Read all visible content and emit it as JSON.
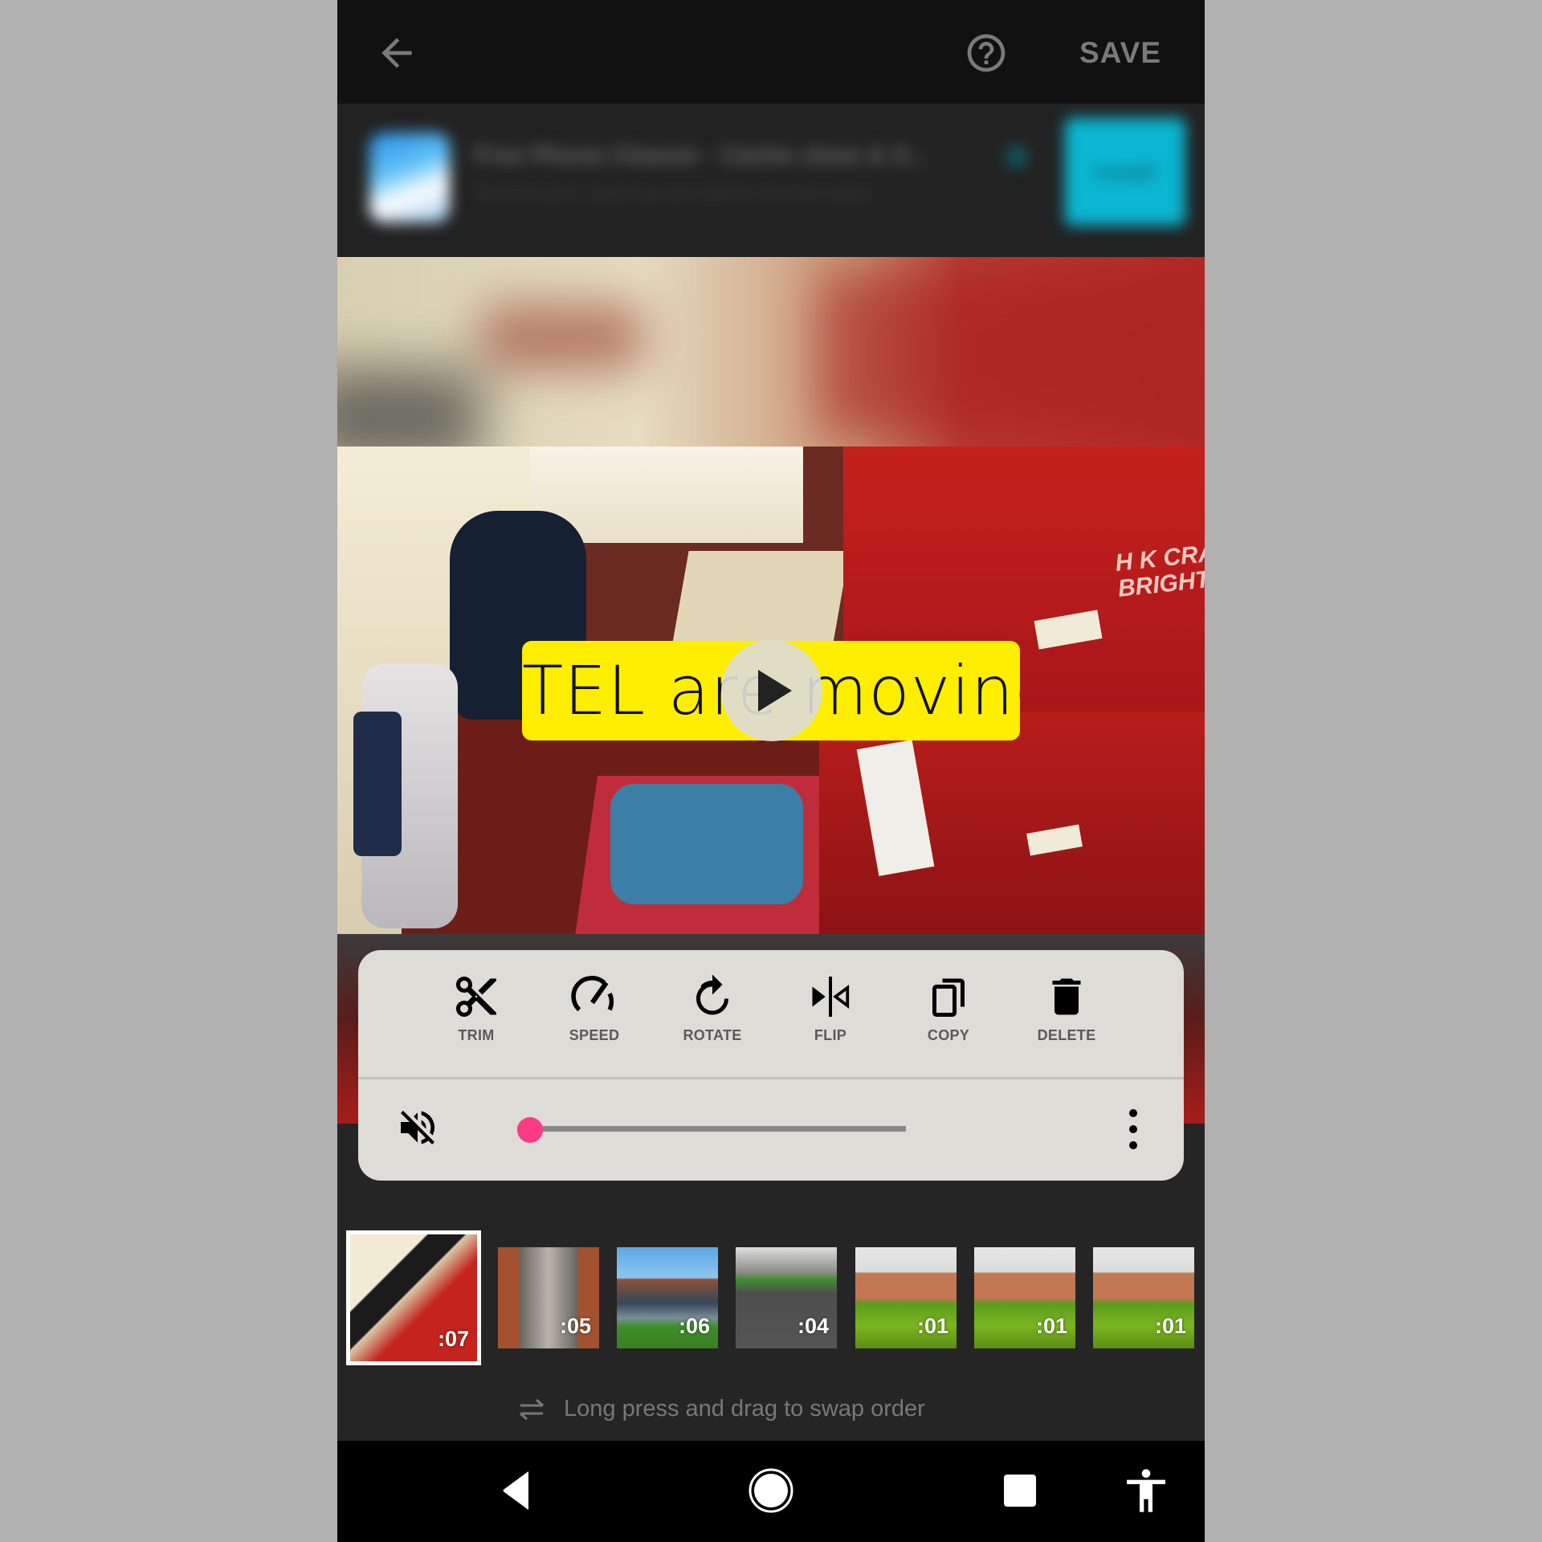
{
  "app_bar": {
    "back_icon": "arrow-left-icon",
    "help_icon": "help-circle-icon",
    "save_label": "SAVE"
  },
  "ad_banner": {
    "title": "Free Phone Cleaner - Cache clean & S...",
    "subtitle": "Remove junk, speed up your phone and free space",
    "cta_label": "Install",
    "note": "blurred advertisement"
  },
  "preview": {
    "caption_text": "TEL are moving",
    "caption_bg_color": "#ffee00",
    "crate_text_line1": "H K CRAT",
    "crate_text_line2": "BRIGHTON O",
    "play_icon": "play-icon"
  },
  "clip_tools": [
    {
      "id": "trim",
      "label": "TRIM",
      "icon": "scissors-icon"
    },
    {
      "id": "speed",
      "label": "SPEED",
      "icon": "speedometer-icon"
    },
    {
      "id": "rotate",
      "label": "ROTATE",
      "icon": "rotate-icon"
    },
    {
      "id": "flip",
      "label": "FLIP",
      "icon": "flip-icon"
    },
    {
      "id": "copy",
      "label": "COPY",
      "icon": "copy-icon"
    },
    {
      "id": "delete",
      "label": "DELETE",
      "icon": "trash-icon"
    }
  ],
  "volume": {
    "muted": true,
    "icon": "volume-off-icon",
    "level_percent": 0,
    "accent_color": "#fd3a84",
    "more_icon": "more-vertical-icon"
  },
  "clips": [
    {
      "duration": ":07",
      "selected": true,
      "scene": "office"
    },
    {
      "duration": ":05",
      "selected": false,
      "scene": "corridor"
    },
    {
      "duration": ":06",
      "selected": false,
      "scene": "building"
    },
    {
      "duration": ":04",
      "selected": false,
      "scene": "path"
    },
    {
      "duration": ":01",
      "selected": false,
      "scene": "grass"
    },
    {
      "duration": ":01",
      "selected": false,
      "scene": "grass"
    },
    {
      "duration": ":01",
      "selected": false,
      "scene": "grass"
    }
  ],
  "hint": {
    "icon": "swap-icon",
    "text": "Long press and drag to swap order"
  },
  "system_nav": {
    "back": "nav-back-icon",
    "home": "nav-home-icon",
    "recents": "nav-recents-icon",
    "accessibility": "accessibility-icon"
  }
}
